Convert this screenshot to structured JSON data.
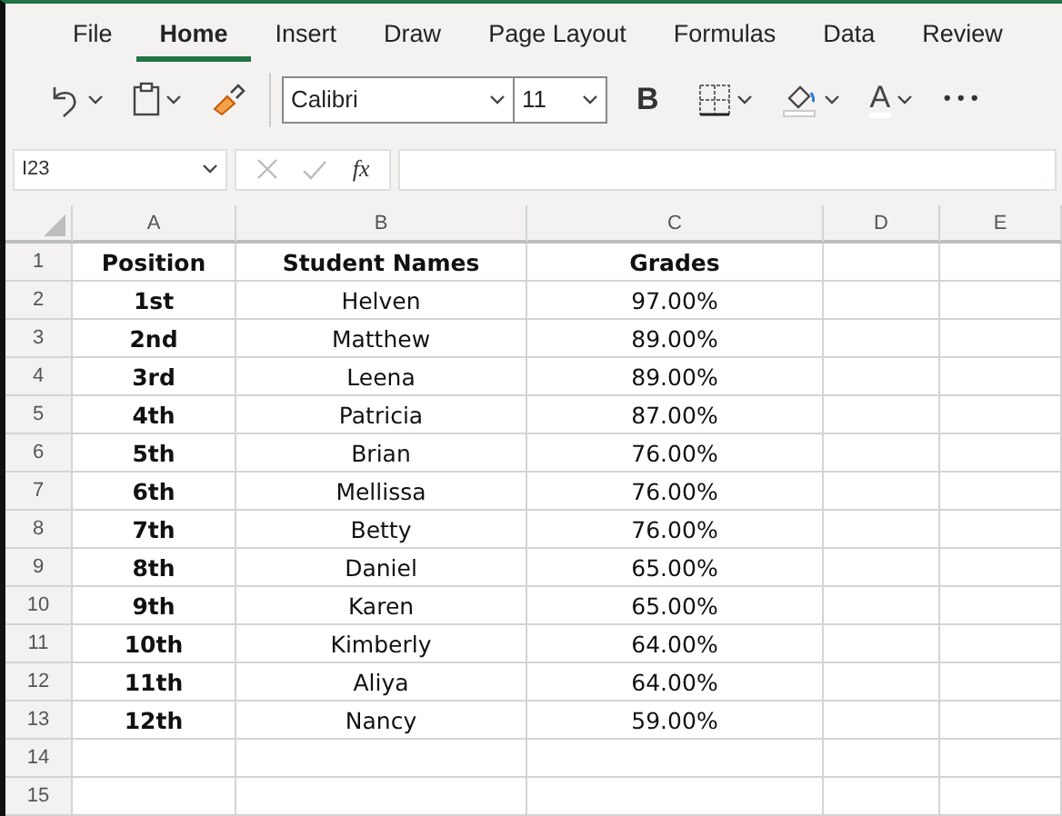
{
  "ribbon_tabs": [
    {
      "label": "File",
      "selected": false
    },
    {
      "label": "Home",
      "selected": true
    },
    {
      "label": "Insert",
      "selected": false
    },
    {
      "label": "Draw",
      "selected": false
    },
    {
      "label": "Page Layout",
      "selected": false
    },
    {
      "label": "Formulas",
      "selected": false
    },
    {
      "label": "Data",
      "selected": false
    },
    {
      "label": "Review",
      "selected": false
    }
  ],
  "toolbar": {
    "font_name": "Calibri",
    "font_size": "11",
    "bold_label": "B",
    "font_color_label": "A",
    "more_label": "•••"
  },
  "formula_bar": {
    "name_box": "I23",
    "fx_label": "fx"
  },
  "sheet": {
    "columns": [
      "A",
      "B",
      "C",
      "D",
      "E"
    ],
    "rows": [
      {
        "number": "1",
        "cells": [
          "Position",
          "Student Names",
          "Grades"
        ]
      },
      {
        "number": "2",
        "cells": [
          "1st",
          "Helven",
          "97.00%"
        ]
      },
      {
        "number": "3",
        "cells": [
          "2nd",
          "Matthew",
          "89.00%"
        ]
      },
      {
        "number": "4",
        "cells": [
          "3rd",
          "Leena",
          "89.00%"
        ]
      },
      {
        "number": "5",
        "cells": [
          "4th",
          "Patricia",
          "87.00%"
        ]
      },
      {
        "number": "6",
        "cells": [
          "5th",
          "Brian",
          "76.00%"
        ]
      },
      {
        "number": "7",
        "cells": [
          "6th",
          "Mellissa",
          "76.00%"
        ]
      },
      {
        "number": "8",
        "cells": [
          "7th",
          "Betty",
          "76.00%"
        ]
      },
      {
        "number": "9",
        "cells": [
          "8th",
          "Daniel",
          "65.00%"
        ]
      },
      {
        "number": "10",
        "cells": [
          "9th",
          "Karen",
          "65.00%"
        ]
      },
      {
        "number": "11",
        "cells": [
          "10th",
          "Kimberly",
          "64.00%"
        ]
      },
      {
        "number": "12",
        "cells": [
          "11th",
          "Aliya",
          "64.00%"
        ]
      },
      {
        "number": "13",
        "cells": [
          "12th",
          "Nancy",
          "59.00%"
        ]
      },
      {
        "number": "14"
      },
      {
        "number": "15"
      }
    ]
  }
}
